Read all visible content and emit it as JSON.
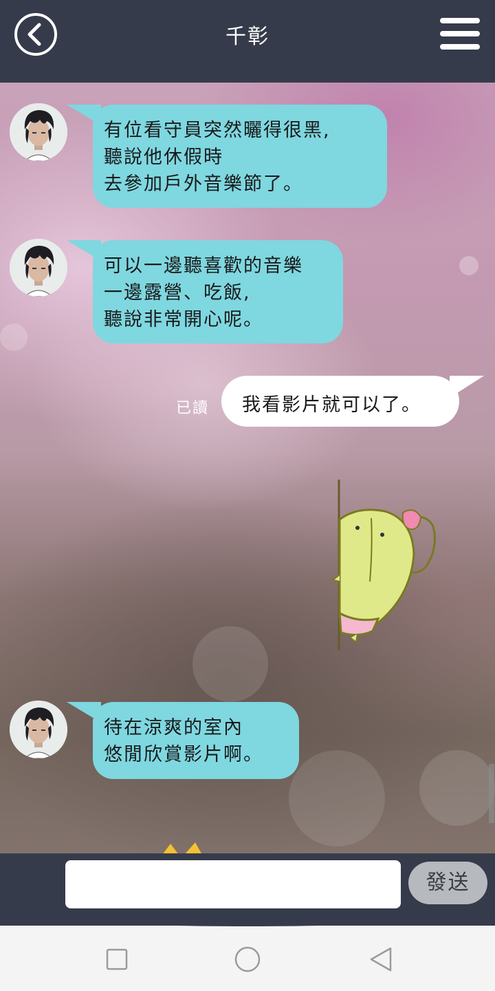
{
  "header": {
    "title": "千彰",
    "back_icon": "chevron-left-circle-icon",
    "menu_icon": "hamburger-menu-icon"
  },
  "messages": [
    {
      "sender": "contact",
      "lines": [
        "有位看守員突然曬得很黑,",
        "聽說他休假時",
        "去參加戶外音樂節了。"
      ]
    },
    {
      "sender": "contact",
      "lines": [
        "可以一邊聽喜歡的音樂",
        "一邊露營、吃飯,",
        "聽說非常開心呢。"
      ]
    },
    {
      "sender": "me",
      "text": "我看影片就可以了。",
      "read_label": "已讀"
    },
    {
      "sender": "me",
      "type": "sticker",
      "sticker_icon": "cactus-peeking-sticker"
    },
    {
      "sender": "contact",
      "lines": [
        "待在涼爽的室內",
        "悠閒欣賞影片啊。"
      ]
    }
  ],
  "input": {
    "value": "",
    "placeholder": "",
    "send_label": "發送"
  },
  "colors": {
    "header_bg": "#363b4b",
    "incoming_bubble": "#7fd7e0",
    "outgoing_bubble": "#ffffff",
    "send_button": "#b6b9bd"
  },
  "system_nav": {
    "recent_icon": "square-recent-apps-icon",
    "home_icon": "circle-home-icon",
    "back_icon": "triangle-back-icon"
  }
}
